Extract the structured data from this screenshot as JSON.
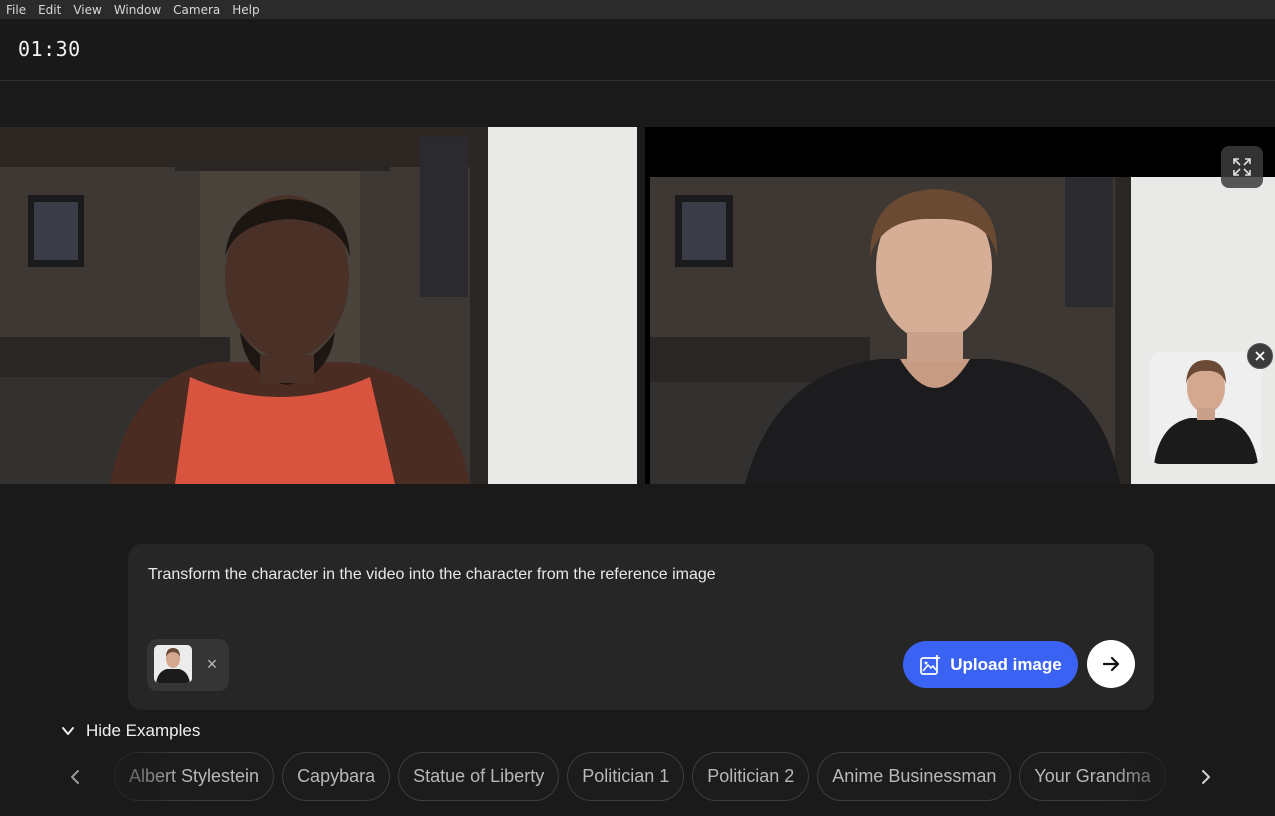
{
  "menubar": {
    "items": [
      "File",
      "Edit",
      "View",
      "Window",
      "Camera",
      "Help"
    ]
  },
  "header": {
    "timer": "01:30"
  },
  "videos": {
    "input_icon": "person-video-feed",
    "output_icon": "person-video-feed",
    "fullscreen_icon": "expand-icon",
    "reference_close_icon": "close-icon"
  },
  "prompt": {
    "text": "Transform the character in the video into the character from the reference image",
    "attachment_remove": "×",
    "upload_label": "Upload image",
    "upload_icon": "image-add-icon",
    "send_icon": "arrow-right-icon",
    "accent_color": "#3b63f3"
  },
  "examples": {
    "toggle_label": "Hide Examples",
    "toggle_icon": "chevron-down-icon",
    "items": [
      "Albert Stylestein",
      "Capybara",
      "Statue of Liberty",
      "Politician 1",
      "Politician 2",
      "Anime Businessman",
      "Your Grandma"
    ],
    "prev_icon": "chevron-left-icon",
    "next_icon": "chevron-right-icon"
  }
}
